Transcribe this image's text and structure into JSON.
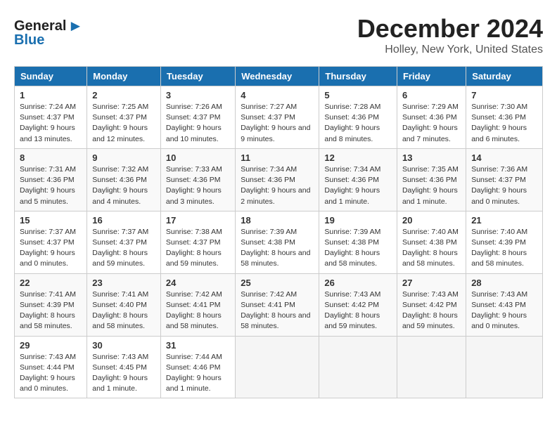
{
  "logo": {
    "text_general": "General",
    "text_blue": "Blue"
  },
  "header": {
    "title": "December 2024",
    "subtitle": "Holley, New York, United States"
  },
  "days_of_week": [
    "Sunday",
    "Monday",
    "Tuesday",
    "Wednesday",
    "Thursday",
    "Friday",
    "Saturday"
  ],
  "weeks": [
    [
      {
        "num": "1",
        "sunrise": "7:24 AM",
        "sunset": "4:37 PM",
        "daylight": "9 hours and 13 minutes."
      },
      {
        "num": "2",
        "sunrise": "7:25 AM",
        "sunset": "4:37 PM",
        "daylight": "9 hours and 12 minutes."
      },
      {
        "num": "3",
        "sunrise": "7:26 AM",
        "sunset": "4:37 PM",
        "daylight": "9 hours and 10 minutes."
      },
      {
        "num": "4",
        "sunrise": "7:27 AM",
        "sunset": "4:37 PM",
        "daylight": "9 hours and 9 minutes."
      },
      {
        "num": "5",
        "sunrise": "7:28 AM",
        "sunset": "4:36 PM",
        "daylight": "9 hours and 8 minutes."
      },
      {
        "num": "6",
        "sunrise": "7:29 AM",
        "sunset": "4:36 PM",
        "daylight": "9 hours and 7 minutes."
      },
      {
        "num": "7",
        "sunrise": "7:30 AM",
        "sunset": "4:36 PM",
        "daylight": "9 hours and 6 minutes."
      }
    ],
    [
      {
        "num": "8",
        "sunrise": "7:31 AM",
        "sunset": "4:36 PM",
        "daylight": "9 hours and 5 minutes."
      },
      {
        "num": "9",
        "sunrise": "7:32 AM",
        "sunset": "4:36 PM",
        "daylight": "9 hours and 4 minutes."
      },
      {
        "num": "10",
        "sunrise": "7:33 AM",
        "sunset": "4:36 PM",
        "daylight": "9 hours and 3 minutes."
      },
      {
        "num": "11",
        "sunrise": "7:34 AM",
        "sunset": "4:36 PM",
        "daylight": "9 hours and 2 minutes."
      },
      {
        "num": "12",
        "sunrise": "7:34 AM",
        "sunset": "4:36 PM",
        "daylight": "9 hours and 1 minute."
      },
      {
        "num": "13",
        "sunrise": "7:35 AM",
        "sunset": "4:36 PM",
        "daylight": "9 hours and 1 minute."
      },
      {
        "num": "14",
        "sunrise": "7:36 AM",
        "sunset": "4:37 PM",
        "daylight": "9 hours and 0 minutes."
      }
    ],
    [
      {
        "num": "15",
        "sunrise": "7:37 AM",
        "sunset": "4:37 PM",
        "daylight": "9 hours and 0 minutes."
      },
      {
        "num": "16",
        "sunrise": "7:37 AM",
        "sunset": "4:37 PM",
        "daylight": "8 hours and 59 minutes."
      },
      {
        "num": "17",
        "sunrise": "7:38 AM",
        "sunset": "4:37 PM",
        "daylight": "8 hours and 59 minutes."
      },
      {
        "num": "18",
        "sunrise": "7:39 AM",
        "sunset": "4:38 PM",
        "daylight": "8 hours and 58 minutes."
      },
      {
        "num": "19",
        "sunrise": "7:39 AM",
        "sunset": "4:38 PM",
        "daylight": "8 hours and 58 minutes."
      },
      {
        "num": "20",
        "sunrise": "7:40 AM",
        "sunset": "4:38 PM",
        "daylight": "8 hours and 58 minutes."
      },
      {
        "num": "21",
        "sunrise": "7:40 AM",
        "sunset": "4:39 PM",
        "daylight": "8 hours and 58 minutes."
      }
    ],
    [
      {
        "num": "22",
        "sunrise": "7:41 AM",
        "sunset": "4:39 PM",
        "daylight": "8 hours and 58 minutes."
      },
      {
        "num": "23",
        "sunrise": "7:41 AM",
        "sunset": "4:40 PM",
        "daylight": "8 hours and 58 minutes."
      },
      {
        "num": "24",
        "sunrise": "7:42 AM",
        "sunset": "4:41 PM",
        "daylight": "8 hours and 58 minutes."
      },
      {
        "num": "25",
        "sunrise": "7:42 AM",
        "sunset": "4:41 PM",
        "daylight": "8 hours and 58 minutes."
      },
      {
        "num": "26",
        "sunrise": "7:43 AM",
        "sunset": "4:42 PM",
        "daylight": "8 hours and 59 minutes."
      },
      {
        "num": "27",
        "sunrise": "7:43 AM",
        "sunset": "4:42 PM",
        "daylight": "8 hours and 59 minutes."
      },
      {
        "num": "28",
        "sunrise": "7:43 AM",
        "sunset": "4:43 PM",
        "daylight": "9 hours and 0 minutes."
      }
    ],
    [
      {
        "num": "29",
        "sunrise": "7:43 AM",
        "sunset": "4:44 PM",
        "daylight": "9 hours and 0 minutes."
      },
      {
        "num": "30",
        "sunrise": "7:43 AM",
        "sunset": "4:45 PM",
        "daylight": "9 hours and 1 minute."
      },
      {
        "num": "31",
        "sunrise": "7:44 AM",
        "sunset": "4:46 PM",
        "daylight": "9 hours and 1 minute."
      },
      null,
      null,
      null,
      null
    ]
  ]
}
